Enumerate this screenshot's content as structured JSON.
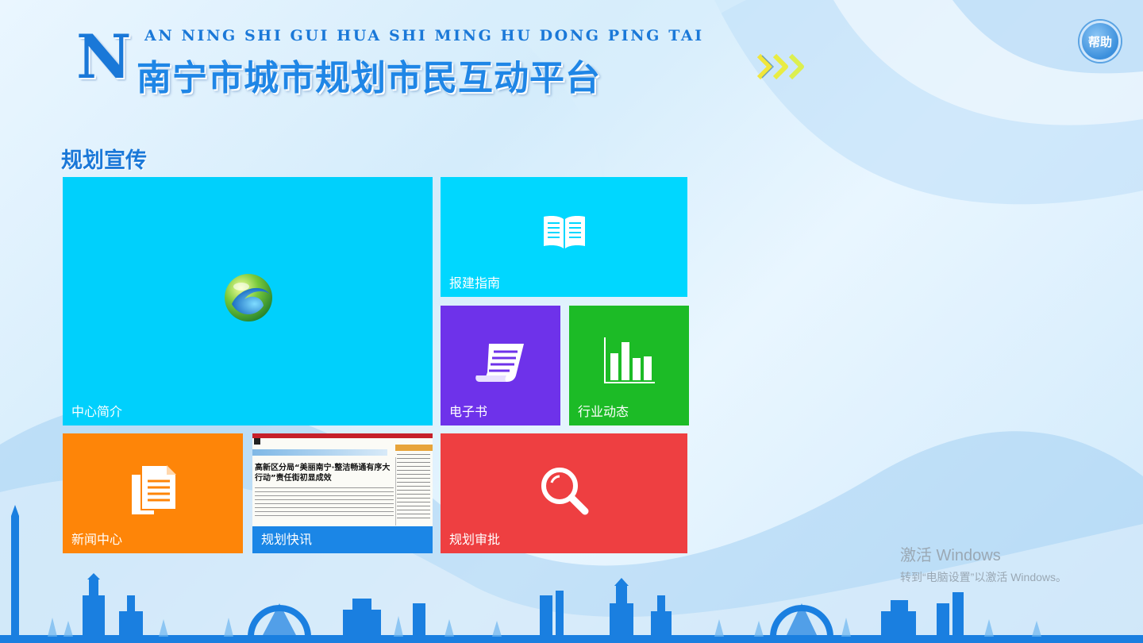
{
  "header": {
    "logo_letter": "N",
    "pinyin": "AN NING SHI GUI HUA SHI MING HU DONG PING TAI",
    "title": "南宁市城市规划市民互动平台",
    "help_label": "帮助"
  },
  "section": {
    "title": "规划宣传"
  },
  "tiles": [
    {
      "label": "中心简介",
      "color": "#00d0fc",
      "icon": "globe-logo-icon"
    },
    {
      "label": "报建指南",
      "color": "#00d7ff",
      "icon": "open-book-icon"
    },
    {
      "label": "电子书",
      "color": "#6e32ea",
      "icon": "scroll-document-icon"
    },
    {
      "label": "行业动态",
      "color": "#1cbb26",
      "icon": "bar-chart-icon"
    },
    {
      "label": "新闻中心",
      "color": "#fe8508",
      "icon": "documents-icon"
    },
    {
      "label": "规划快讯",
      "color": "#1b86e6",
      "icon": "newspaper-thumbnail"
    },
    {
      "label": "规划审批",
      "color": "#ee3f41",
      "icon": "magnifier-icon"
    }
  ],
  "newspaper": {
    "headline": "高新区分局“美丽南宁·整洁畅通有序大行动”责任街初显成效"
  },
  "watermark": {
    "line1": "激活 Windows",
    "line2": "转到“电脑设置”以激活 Windows。"
  }
}
